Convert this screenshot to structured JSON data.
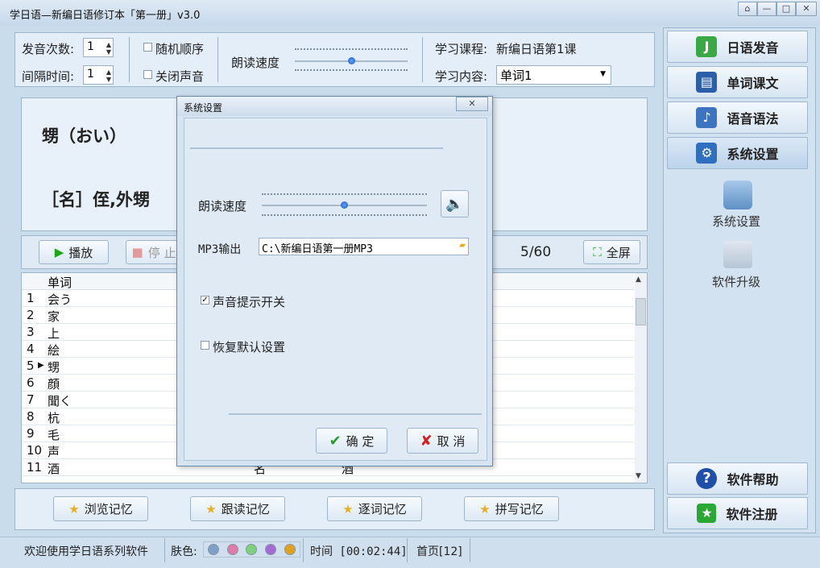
{
  "window": {
    "title": "学日语—新编日语修订本「第一册」v3.0"
  },
  "top": {
    "pron_count_label": "发音次数:",
    "pron_count_value": "1",
    "interval_label": "间隔时间:",
    "interval_value": "1",
    "random_label": "随机顺序",
    "mute_label": "关闭声音",
    "speed_label": "朗读速度",
    "course_label": "学习课程:",
    "course_value": "新编日语第1课",
    "content_label": "学习内容:",
    "content_value": "单词1"
  },
  "word_display": {
    "line1": "甥（おい）",
    "line2": "［名］侄,外甥"
  },
  "toolbar": {
    "play": "播放",
    "stop": "停 止",
    "counter": "5/60",
    "fullscreen": "全屏"
  },
  "table": {
    "header": "单词",
    "rows": [
      {
        "n": "1",
        "w": "会う"
      },
      {
        "n": "2",
        "w": "家"
      },
      {
        "n": "3",
        "w": "上"
      },
      {
        "n": "4",
        "w": "絵"
      },
      {
        "n": "5",
        "w": "甥"
      },
      {
        "n": "6",
        "w": "顔"
      },
      {
        "n": "7",
        "w": "聞く"
      },
      {
        "n": "8",
        "w": "杭"
      },
      {
        "n": "9",
        "w": "毛"
      },
      {
        "n": "10",
        "w": "声"
      },
      {
        "n": "11",
        "w": "酒"
      }
    ],
    "row11_extra1": "名",
    "row11_extra2": "酒"
  },
  "memory_buttons": [
    "浏览记忆",
    "跟读记忆",
    "逐词记忆",
    "拼写记忆"
  ],
  "nav": {
    "items": [
      "日语发音",
      "单词课文",
      "语音语法",
      "系统设置"
    ],
    "sub_items": [
      "系统设置",
      "软件升级"
    ],
    "help": "软件帮助",
    "register": "软件注册"
  },
  "dialog": {
    "title": "系统设置",
    "speed_label": "朗读速度",
    "mp3_label": "MP3输出",
    "mp3_value": "C:\\新编日语第一册MP3",
    "sound_toggle": "声音提示开关",
    "restore_default": "恢复默认设置",
    "ok": "确 定",
    "cancel": "取 消",
    "sound_toggle_checked": true,
    "restore_checked": false,
    "speed_level": 0.5
  },
  "status": {
    "welcome": "欢迎使用学日语系列软件",
    "skin_label": "肤色:",
    "skin_colors": [
      "#7f9fc6",
      "#e07aa8",
      "#7fd07a",
      "#a46ad4",
      "#e0a020"
    ],
    "time": "时间 [00:02:44]",
    "page": "首页[12]"
  },
  "colors": {
    "accent": "#1b59c8",
    "window_bg": "#c9dcec"
  }
}
